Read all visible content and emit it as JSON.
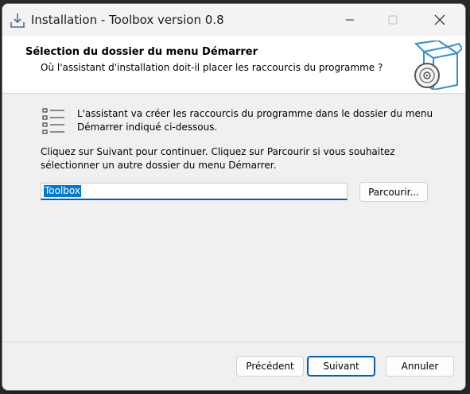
{
  "window": {
    "title": "Installation - Toolbox version 0.8"
  },
  "header": {
    "title": "Sélection du dossier du menu Démarrer",
    "subtitle": "Où l'assistant d'installation doit-il placer les raccourcis du programme ?"
  },
  "body": {
    "info_line1": "L'assistant va créer les raccourcis du programme dans le dossier du menu",
    "info_line2": "Démarrer indiqué ci-dessous.",
    "instruct_line1": "Cliquez sur Suivant pour continuer. Cliquez sur Parcourir si vous souhaitez",
    "instruct_line2": "sélectionner un autre dossier du menu Démarrer.",
    "folder_value": "Toolbox",
    "browse_label": "Parcourir..."
  },
  "footer": {
    "back_label": "Précédent",
    "next_label": "Suivant",
    "cancel_label": "Annuler"
  },
  "icons": {
    "app": "installer-download-icon",
    "header": "software-box-cd-icon",
    "list": "list-icon"
  },
  "colors": {
    "accent": "#005fb8",
    "selection": "#0078d7",
    "window_bg": "#f0f0f0",
    "header_bg": "#ffffff"
  }
}
